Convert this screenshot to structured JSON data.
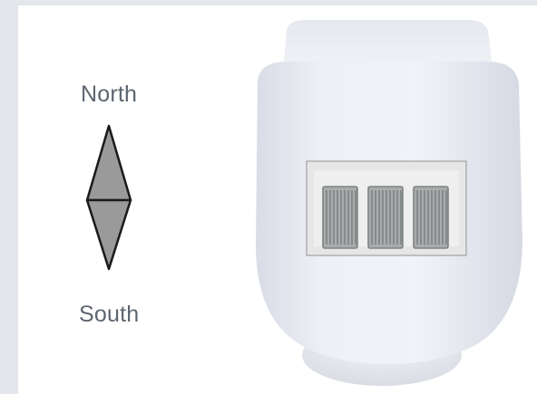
{
  "compass": {
    "north_label": "North",
    "south_label": "South",
    "north_icon": "compass-north-arrow-icon",
    "colors": {
      "fill": "#9a9a9a",
      "stroke": "#1a1a1a",
      "text": "#5d6670"
    }
  },
  "device": {
    "icon": "sensor-device-image",
    "colors": {
      "body": "#eef0f6",
      "body_shadow": "#c9ccd6",
      "chip_bg": "#e9e9e9",
      "chip_coil": "#8b8f8f"
    }
  }
}
